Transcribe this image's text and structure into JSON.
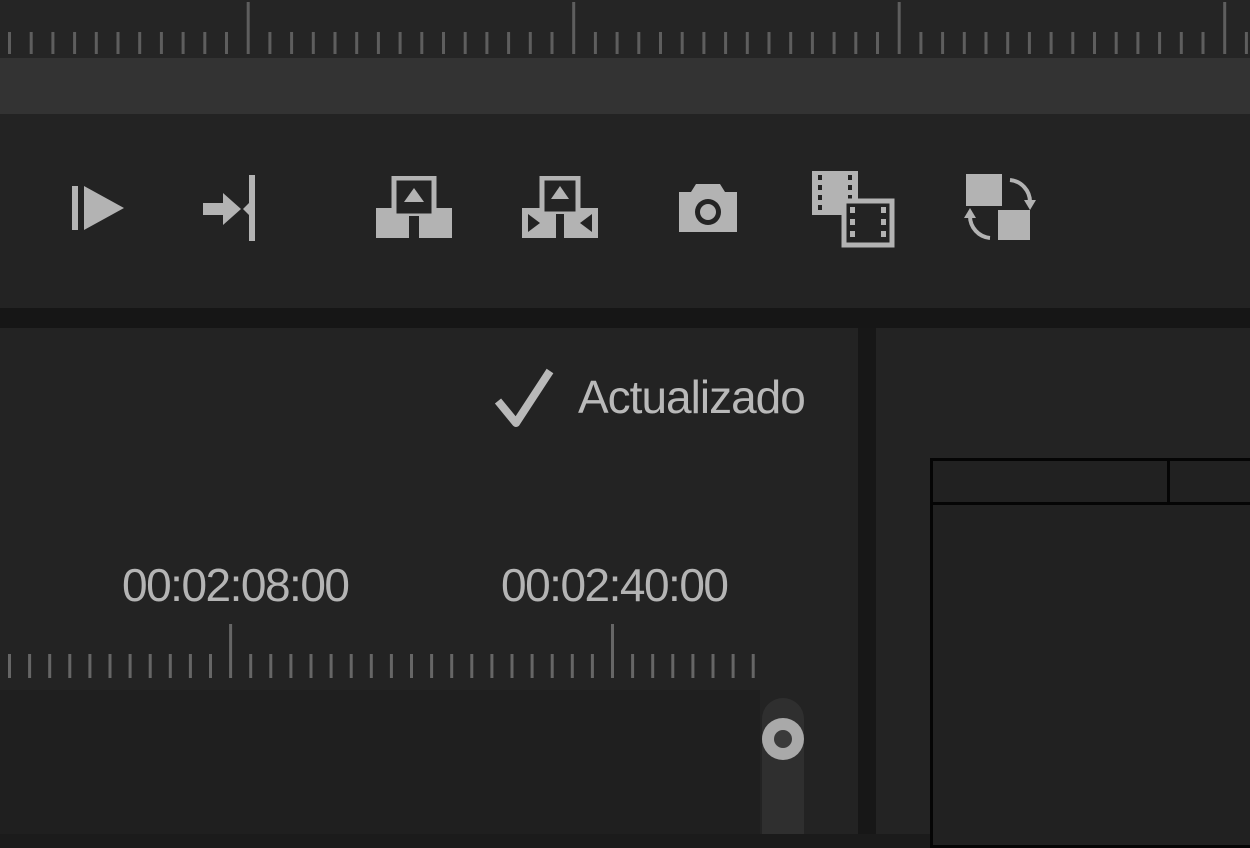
{
  "status": {
    "text": "Actualizado",
    "icon": "checkmark-icon"
  },
  "timeline": {
    "timecodes": [
      "00:02:08:00",
      "00:02:40:00"
    ]
  },
  "toolbar": {
    "buttons": [
      {
        "name": "play-in-to-out",
        "icon": "play-in-to-out-icon"
      },
      {
        "name": "go-to-out-point",
        "icon": "go-to-out-point-icon"
      },
      {
        "name": "lift",
        "icon": "lift-icon"
      },
      {
        "name": "extract",
        "icon": "extract-icon"
      },
      {
        "name": "export-frame",
        "icon": "camera-icon"
      },
      {
        "name": "insert-overlay",
        "icon": "film-overlay-icon"
      },
      {
        "name": "compare-view",
        "icon": "swap-icon"
      }
    ]
  },
  "colors": {
    "background": "#1b1b1b",
    "panel": "#232323",
    "icon": "#b3b3b3",
    "text": "#b9b9b9"
  }
}
